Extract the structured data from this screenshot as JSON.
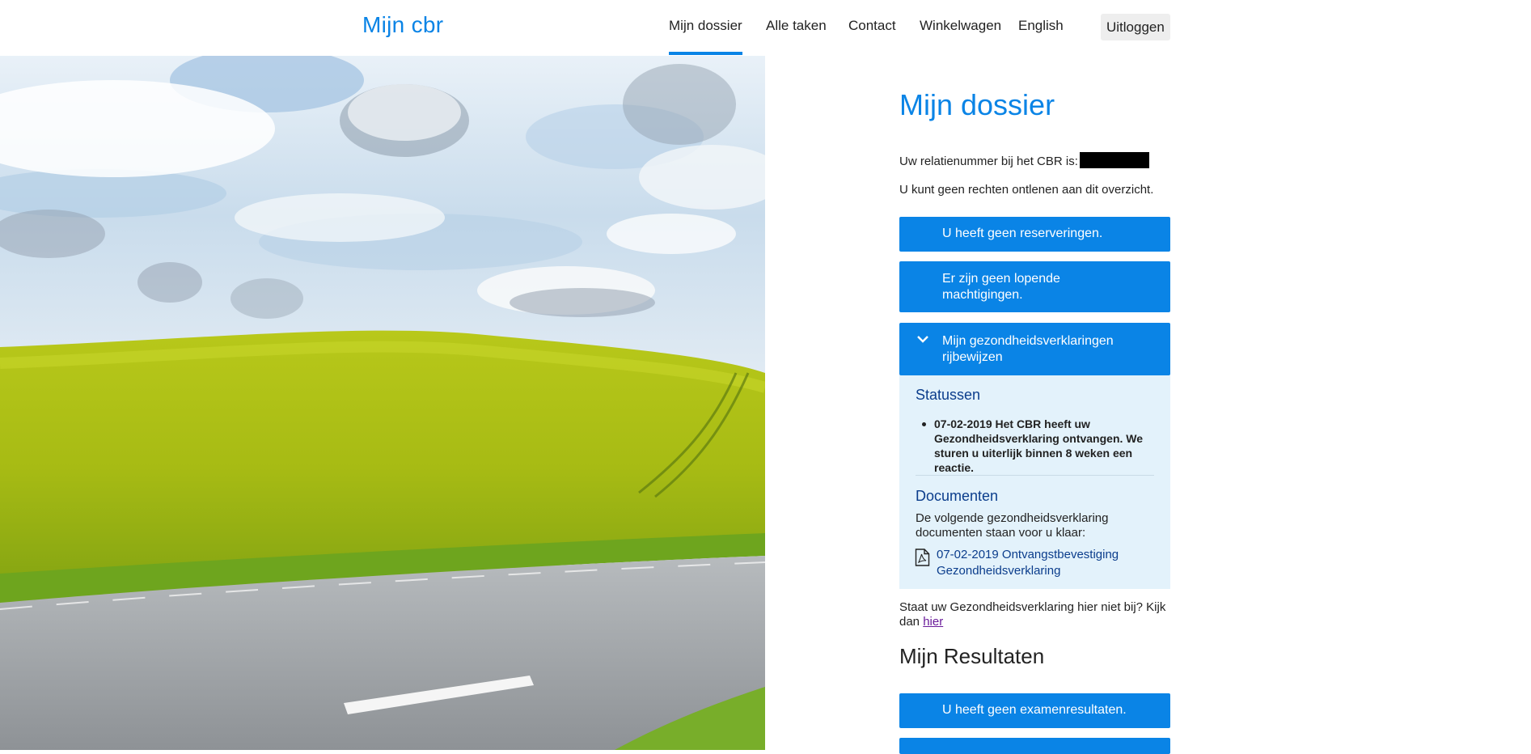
{
  "header": {
    "logo": "Mijn cbr",
    "nav": [
      {
        "label": "Mijn dossier",
        "active": true
      },
      {
        "label": "Alle taken",
        "active": false
      },
      {
        "label": "Contact",
        "active": false
      },
      {
        "label": "Winkelwagen",
        "active": false
      },
      {
        "label": "English",
        "active": false
      }
    ],
    "logout": "Uitloggen"
  },
  "main": {
    "title": "Mijn dossier",
    "relation_text": "Uw relatienummer bij het CBR is:",
    "disclaimer": "U kunt geen rechten ontlenen aan dit overzicht.",
    "buttons": {
      "reservations": "U heeft geen reserveringen.",
      "authorizations": "Er zijn geen lopende machtigingen.",
      "health": "Mijn gezondheidsverklaringen rijbewijzen",
      "results": "U heeft geen examenresultaten."
    },
    "health_panel": {
      "status_heading": "Statussen",
      "status_items": [
        "07-02-2019 Het CBR heeft uw Gezondheidsverklaring ontvangen. We sturen u uiterlijk binnen 8 weken een reactie."
      ],
      "documents_heading": "Documenten",
      "documents_intro": "De volgende gezondheidsverklaring documenten staan voor u klaar:",
      "document_link": "07-02-2019  Ontvangstbevestiging Gezondheidsverklaring"
    },
    "footnote_text": "Staat uw Gezondheidsverklaring hier niet bij? Kijk dan",
    "footnote_link": "hier",
    "results_heading": "Mijn Resultaten"
  },
  "colors": {
    "accent": "#0a84e6",
    "panel_bg": "#e3f2fb",
    "heading_dark_blue": "#0b3d8c",
    "visited_link": "#6a1b9a"
  },
  "icons": {
    "expanded_chevron": "chevron-down-icon",
    "document": "pdf-document-icon"
  }
}
